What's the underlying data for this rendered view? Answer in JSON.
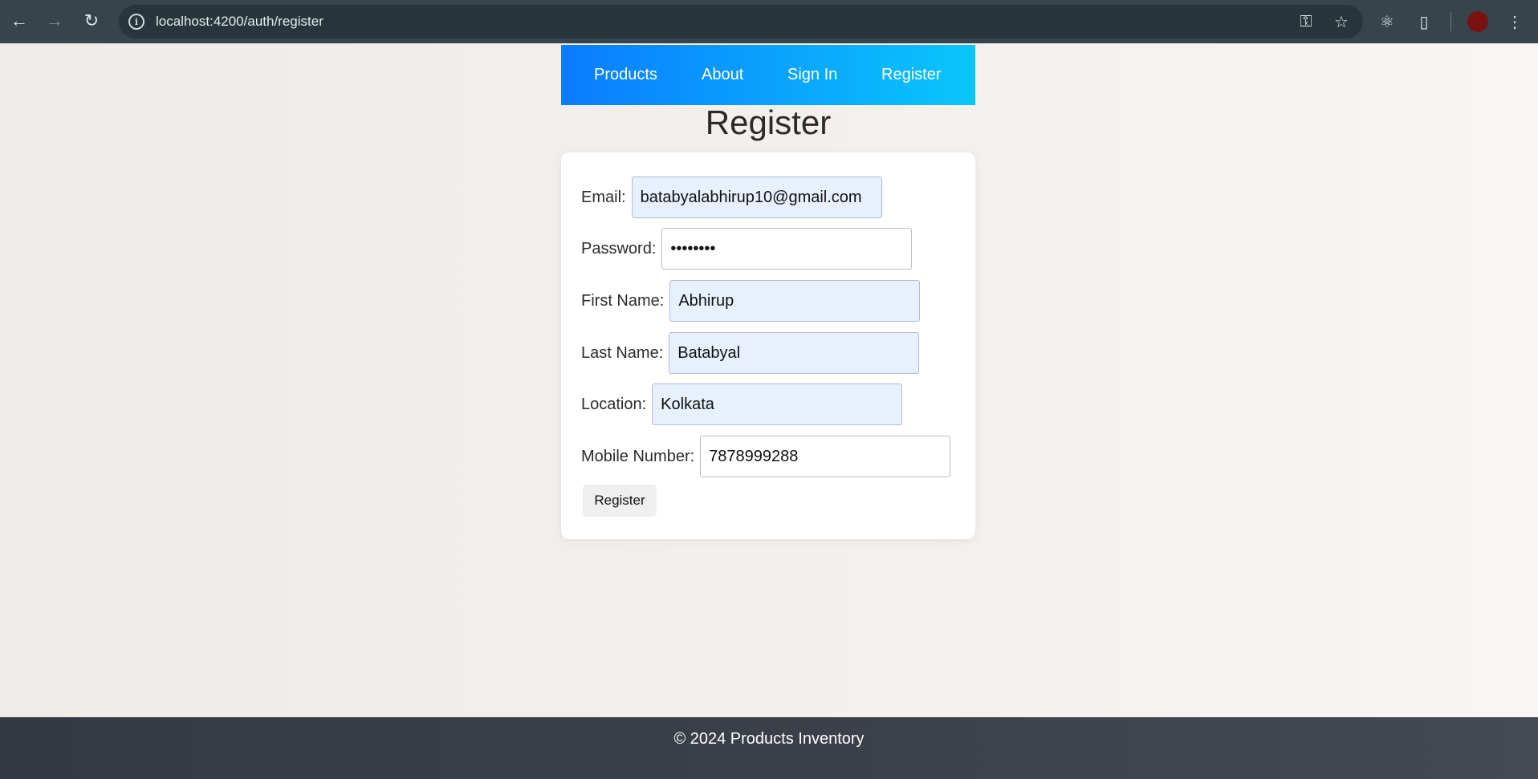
{
  "browser": {
    "url": "localhost:4200/auth/register",
    "icons": [
      "back-arrow-icon",
      "forward-arrow-icon",
      "reload-icon",
      "info-icon",
      "password-key-icon",
      "bookmark-star-icon",
      "react-devtools-icon",
      "extensions-puzzle-icon",
      "profile-avatar",
      "more-menu-icon"
    ]
  },
  "navbar": {
    "items": [
      {
        "label": "Products"
      },
      {
        "label": "About"
      },
      {
        "label": "Sign In"
      },
      {
        "label": "Register"
      }
    ],
    "gradient": [
      "#0a7cff",
      "#0ac6fb"
    ]
  },
  "page": {
    "title": "Register"
  },
  "form": {
    "email": {
      "label": "Email:",
      "value": "batabyalabhirup10@gmail.com"
    },
    "password": {
      "label": "Password:",
      "value": "••••••••"
    },
    "first_name": {
      "label": "First Name:",
      "value": "Abhirup"
    },
    "last_name": {
      "label": "Last Name:",
      "value": "Batabyal"
    },
    "location": {
      "label": "Location:",
      "value": "Kolkata"
    },
    "mobile": {
      "label": "Mobile Number:",
      "value": "7878999288"
    },
    "submit_label": "Register"
  },
  "footer": {
    "text": "© 2024 Products Inventory"
  }
}
